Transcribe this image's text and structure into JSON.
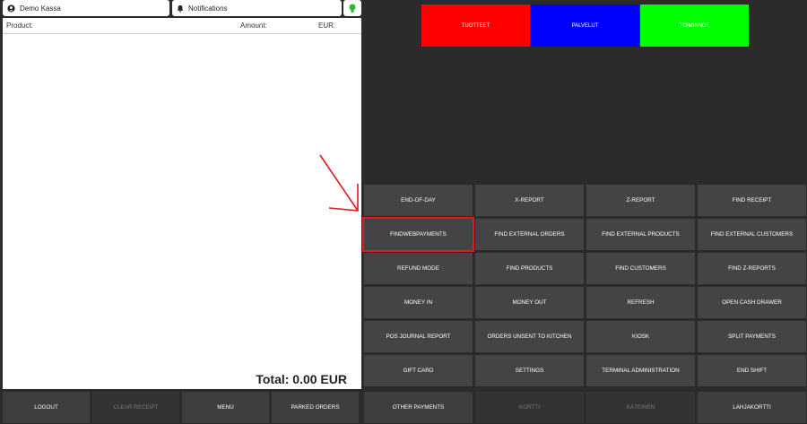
{
  "topbar": {
    "user_label": "Demo Kassa",
    "notifications_label": "Notifications"
  },
  "receipt": {
    "col_product": "Product:",
    "col_amount": "Amount:",
    "col_currency": "EUR:",
    "total_label": "Total: 0.00 EUR"
  },
  "categories": [
    {
      "label": "TUOTTEET",
      "color": "#ff0000"
    },
    {
      "label": "PALVELUT",
      "color": "#0000ff"
    },
    {
      "label": "TOIMINNOT",
      "color": "#00ff00"
    }
  ],
  "functions": [
    "END-OF-DAY",
    "X-REPORT",
    "Z-REPORT",
    "FIND RECEIPT",
    "FINDWEBPAYMENTS",
    "FIND EXTERNAL ORDERS",
    "FIND EXTERNAL PRODUCTS",
    "FIND EXTERNAL CUSTOMERS",
    "REFUND MODE",
    "FIND PRODUCTS",
    "FIND CUSTOMERS",
    "FIND Z-REPORTS",
    "MONEY IN",
    "MONEY OUT",
    "REFRESH",
    "OPEN CASH DRAWER",
    "POS JOURNAL REPORT",
    "ORDERS UNSENT TO KITCHEN",
    "KIOSK",
    "SPLIT PAYMENTS",
    "GIFT CARD",
    "SETTINGS",
    "TERMINAL ADMINISTRATION",
    "END SHIFT"
  ],
  "bottom_left": [
    "LOGOUT",
    "CLEAR RECEIPT",
    "MENU",
    "PARKED ORDERS"
  ],
  "bottom_right": [
    "OTHER PAYMENTS",
    "KORTTI",
    "KÄTEINEN",
    "LAHJAKORTTI"
  ],
  "colors": {
    "highlight": "#e01b1b",
    "status_green": "#2db82d"
  }
}
